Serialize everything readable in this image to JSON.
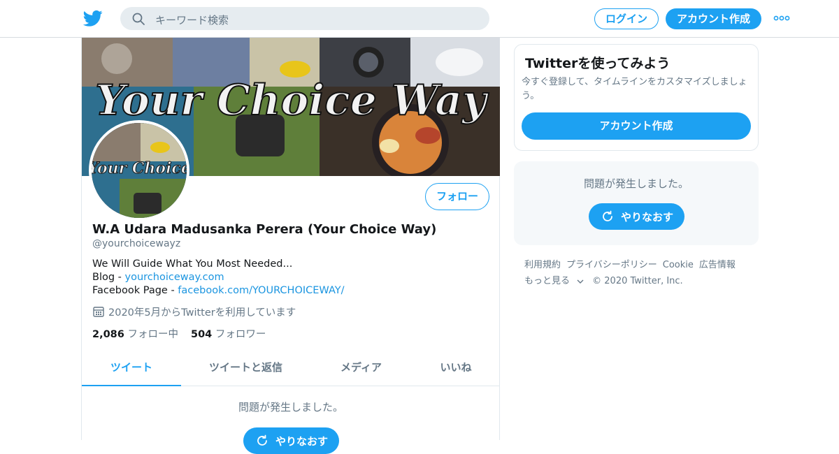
{
  "header": {
    "search_placeholder": "キーワード検索",
    "login_label": "ログイン",
    "signup_label": "アカウント作成"
  },
  "profile": {
    "banner_text": "Your Choice Way",
    "avatar_text": "Your Choice",
    "follow_label": "フォロー",
    "name": "W.A Udara Madusanka Perera (Your Choice Way)",
    "handle": "@yourchoicewayz",
    "bio_line1": "We Will Guide What You Most Needed...",
    "bio_blog_prefix": "Blog - ",
    "bio_blog_link": "yourchoiceway.com",
    "bio_fb_prefix": "Facebook Page - ",
    "bio_fb_link": "facebook.com/YOURCHOICEWAY/",
    "joined": "2020年5月からTwitterを利用しています",
    "following_count": "2,086",
    "following_label": "フォロー中",
    "followers_count": "504",
    "followers_label": "フォロワー"
  },
  "tabs": [
    {
      "label": "ツイート",
      "active": true
    },
    {
      "label": "ツイートと返信",
      "active": false
    },
    {
      "label": "メディア",
      "active": false
    },
    {
      "label": "いいね",
      "active": false
    }
  ],
  "timeline": {
    "error_message": "問題が発生しました。",
    "retry_label": "やりなおす"
  },
  "sidebar": {
    "signup_card": {
      "title": "Twitterを使ってみよう",
      "description": "今すぐ登録して、タイムラインをカスタマイズしましょう。",
      "button_label": "アカウント作成"
    },
    "error_card": {
      "message": "問題が発生しました。",
      "retry_label": "やりなおす"
    },
    "footer": {
      "links": [
        "利用規約",
        "プライバシーポリシー",
        "Cookie",
        "広告情報"
      ],
      "more_label": "もっと見る",
      "copyright": "© 2020 Twitter, Inc."
    }
  },
  "colors": {
    "accent": "#1da1f2",
    "text_secondary": "#657786",
    "link": "#1b95e0"
  }
}
